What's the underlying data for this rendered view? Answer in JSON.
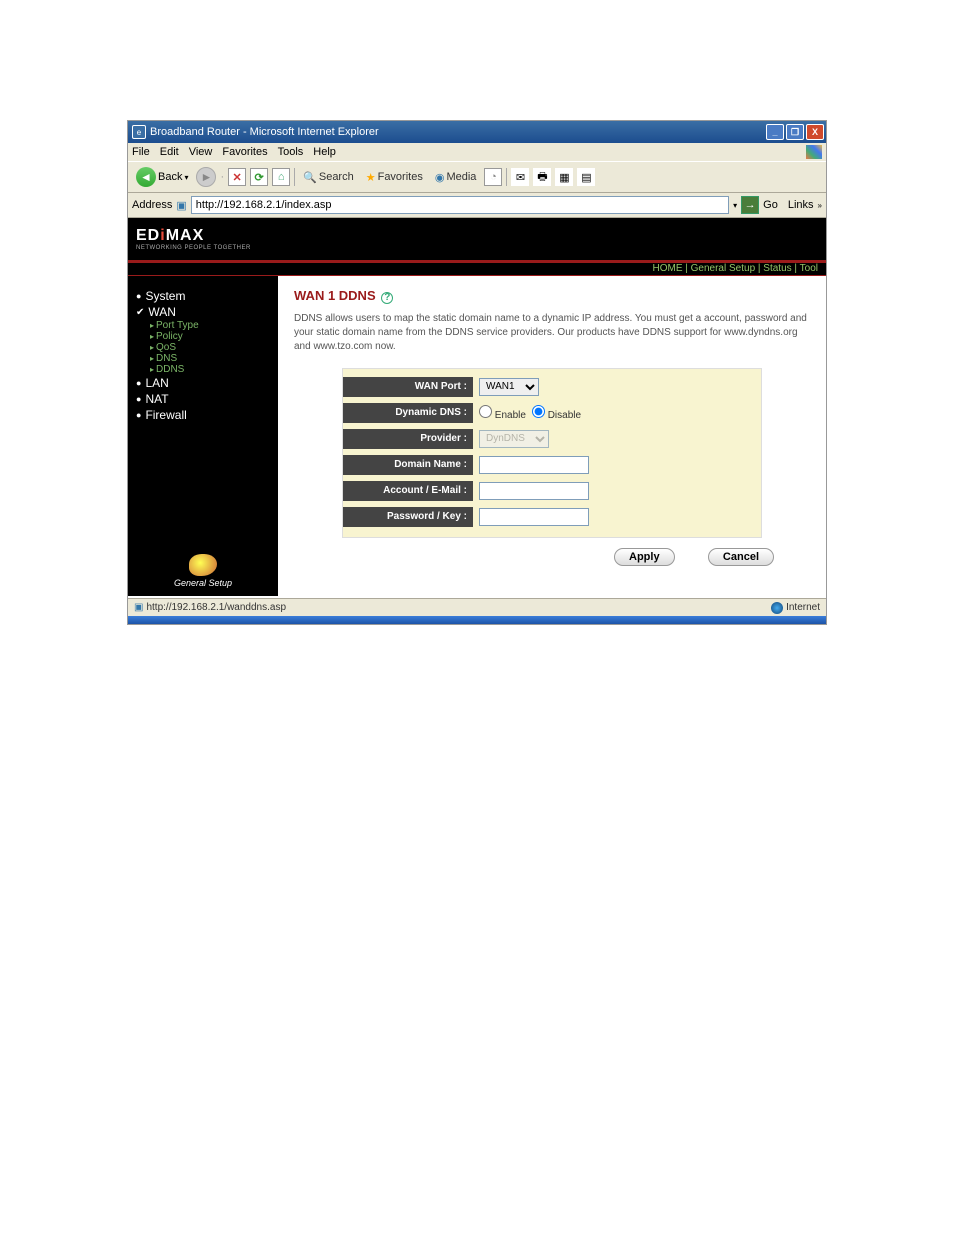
{
  "browser": {
    "title": "Broadband Router - Microsoft Internet Explorer",
    "menu": {
      "file": "File",
      "edit": "Edit",
      "view": "View",
      "favorites": "Favorites",
      "tools": "Tools",
      "help": "Help"
    },
    "toolbar": {
      "back": "Back",
      "search": "Search",
      "favorites": "Favorites",
      "media": "Media"
    },
    "address_label": "Address",
    "url": "http://192.168.2.1/index.asp",
    "go": "Go",
    "links": "Links"
  },
  "header": {
    "logo_main": "EDIMAX",
    "logo_sub": "NETWORKING PEOPLE TOGETHER",
    "tabs": {
      "home": "HOME",
      "general": "General Setup",
      "status": "Status",
      "tool": "Tool"
    }
  },
  "sidebar": {
    "items": [
      {
        "label": "System",
        "type": "bullet"
      },
      {
        "label": "WAN",
        "type": "check",
        "sub": [
          "Port Type",
          "Policy",
          "QoS",
          "DNS",
          "DDNS"
        ]
      },
      {
        "label": "LAN",
        "type": "bullet"
      },
      {
        "label": "NAT",
        "type": "bullet"
      },
      {
        "label": "Firewall",
        "type": "bullet"
      }
    ],
    "footer": "General Setup"
  },
  "page": {
    "title": "WAN 1 DDNS",
    "description": "DDNS allows users to map the static domain name to a dynamic IP address. You must get a account, password and your static domain name from the DDNS service providers. Our products have DDNS support for www.dyndns.org and www.tzo.com now.",
    "labels": {
      "wan_port": "WAN Port :",
      "dynamic_dns": "Dynamic DNS :",
      "provider": "Provider :",
      "domain_name": "Domain Name :",
      "account": "Account / E-Mail :",
      "password": "Password / Key :"
    },
    "fields": {
      "wan_port_value": "WAN1",
      "enable": "Enable",
      "disable": "Disable",
      "provider_value": "DynDNS"
    },
    "buttons": {
      "apply": "Apply",
      "cancel": "Cancel"
    }
  },
  "statusbar": {
    "url": "http://192.168.2.1/wanddns.asp",
    "zone": "Internet"
  }
}
